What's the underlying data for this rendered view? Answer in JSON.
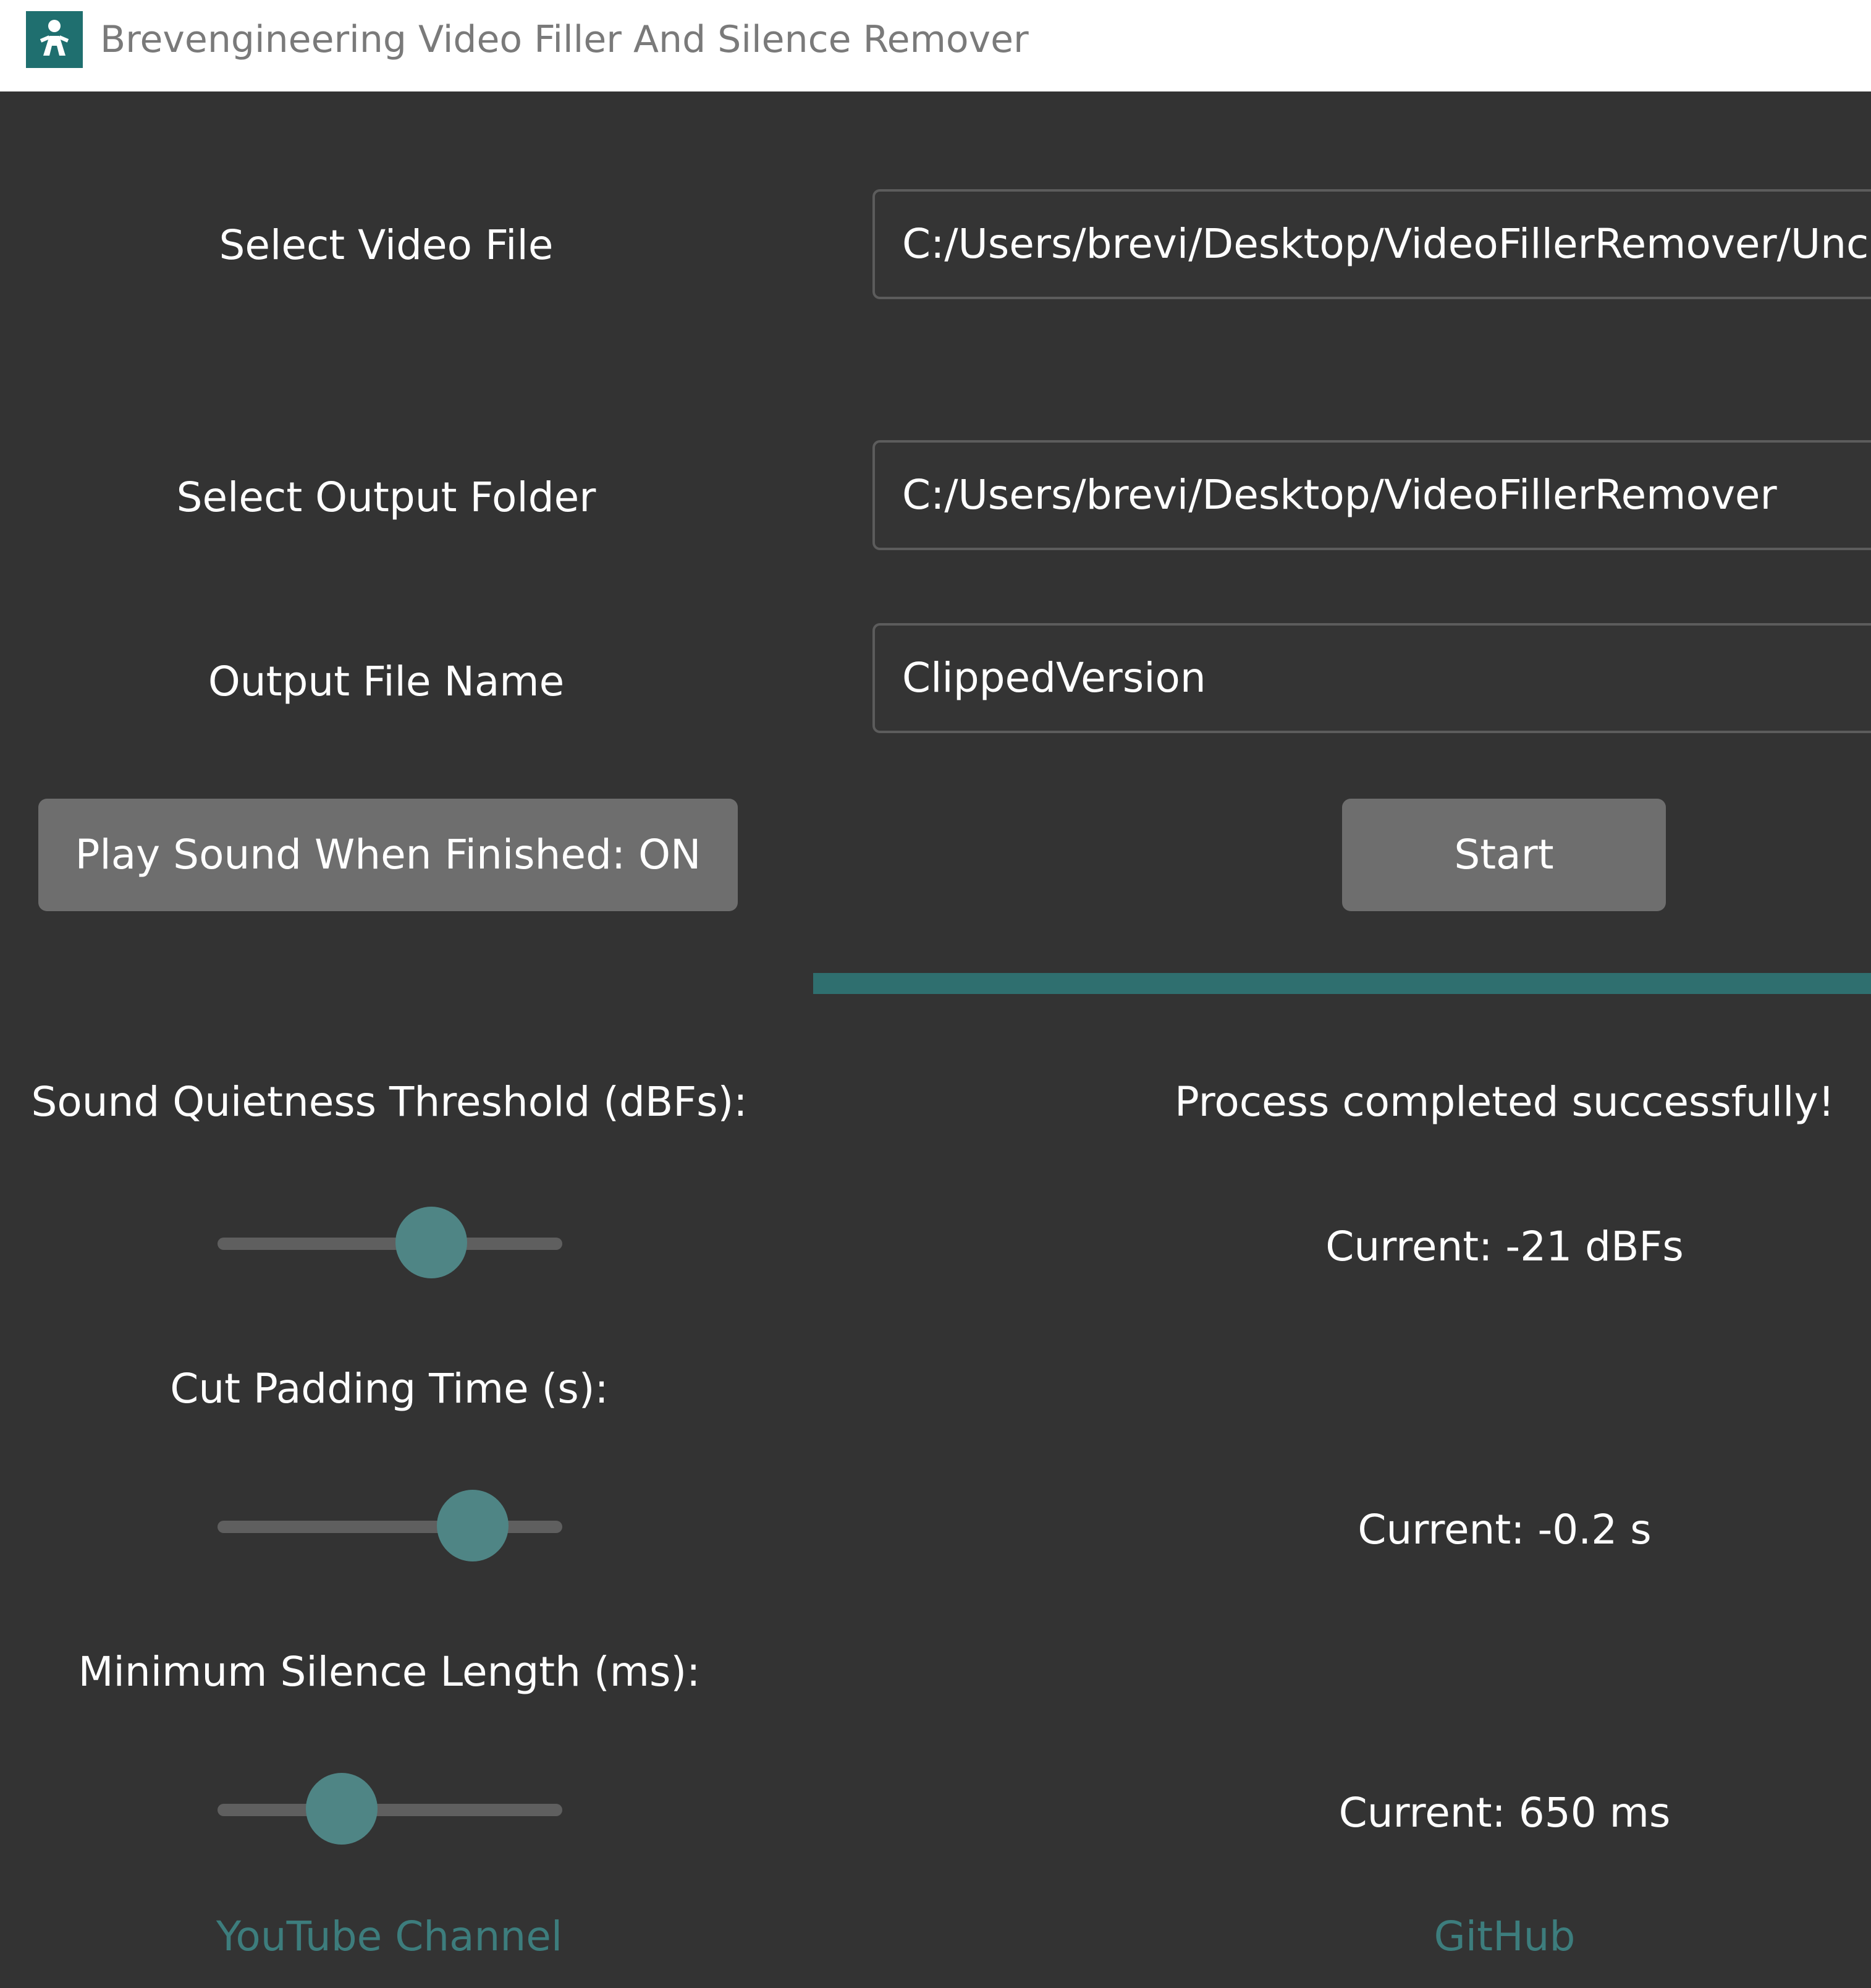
{
  "window": {
    "title": "Brevengineering Video Filler And Silence Remover",
    "icon": "app-icon"
  },
  "form": {
    "video_file_label": "Select Video File",
    "video_file_value": "C:/Users/brevi/Desktop/VideoFillerRemover/Unc",
    "output_folder_label": "Select Output Folder",
    "output_folder_value": "C:/Users/brevi/Desktop/VideoFillerRemover",
    "output_name_label": "Output File Name",
    "output_name_value": "ClippedVersion"
  },
  "controls": {
    "sound_toggle_label": "Play Sound When Finished: ON",
    "start_label": "Start"
  },
  "progress": {
    "fraction": 1.0,
    "status": "Process completed successfully!"
  },
  "sliders": {
    "threshold": {
      "label": "Sound Quietness Threshold (dBFs):",
      "current": "Current: -21 dBFs",
      "fraction": 0.62
    },
    "padding": {
      "label": "Cut Padding Time (s):",
      "current": "Current: -0.2 s",
      "fraction": 0.74
    },
    "min_silence": {
      "label": "Minimum Silence Length (ms):",
      "current": "Current: 650 ms",
      "fraction": 0.36
    }
  },
  "links": {
    "youtube": "YouTube Channel",
    "github": "GitHub"
  },
  "colors": {
    "background": "#333333",
    "accent": "#4f8585",
    "link": "#3d7d7d",
    "button": "#6e6e6e"
  }
}
